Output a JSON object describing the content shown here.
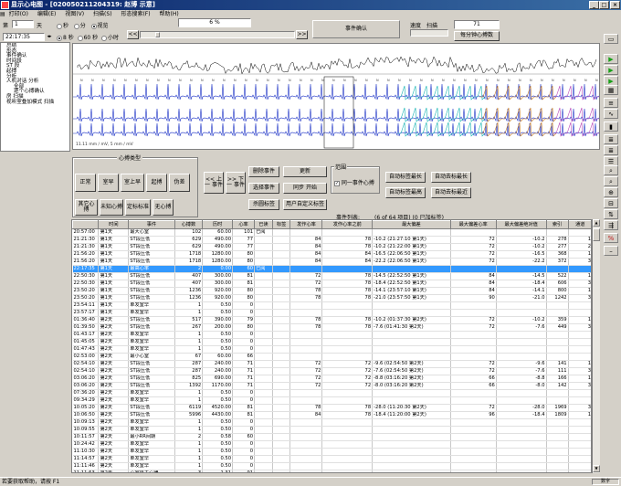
{
  "title": "显示心电图 - [020050211204319: 赵博 示意]",
  "menu": [
    "打印(O)",
    "编辑(E)",
    "视图(V)",
    "扫描(S)",
    "形态搜索(F)",
    "帮助(H)"
  ],
  "controls": {
    "day_label": "第",
    "day_value": "1",
    "day_unit": "天",
    "time_value": "22:17:35",
    "interval_options": [
      "秒",
      "分",
      "视览"
    ],
    "hour_options": [
      "8 秒",
      "60 秒",
      "小时"
    ],
    "percent_value": "6 %",
    "prev_label": "<<",
    "next_label": ">>",
    "event_confirm_label": "事件确认",
    "speed_label": "速度",
    "scan_label": "扫描",
    "speed_value": "71",
    "per_min_label": "每分钟心搏数"
  },
  "tree": [
    {
      "text": "总结",
      "indent": 0
    },
    {
      "text": "形态",
      "indent": 0
    },
    {
      "text": "事件确认",
      "indent": 0
    },
    {
      "text": "时间段",
      "indent": 0
    },
    {
      "text": "ST 段",
      "indent": 0
    },
    {
      "text": "起搏",
      "indent": 0
    },
    {
      "text": "分析",
      "indent": 0
    },
    {
      "text": "人机对话 分析",
      "indent": 0
    },
    {
      "text": "全部",
      "indent": 1
    },
    {
      "text": "逐个心搏确认",
      "indent": 1
    },
    {
      "text": "房 扫描",
      "indent": 0
    },
    {
      "text": "视听室叠加模式 扫描",
      "indent": 0
    }
  ],
  "ecg": {
    "scale_note": "11.11 mm / mV, 5 mm / mV"
  },
  "beat_type": {
    "title": "心搏类型",
    "buttons": [
      "正常",
      "室早",
      "室上早",
      "起搏",
      "伪差",
      "其它心搏",
      "未知心搏",
      "定标标准",
      "无心搏"
    ],
    "prev_event": "<< 上一 事件",
    "next_event": ">> 下一 事件"
  },
  "event_buttons": {
    "delete": "删除事件",
    "update": "更新",
    "select": "选择事件",
    "sync_start": "同步 开始",
    "prune": "杀圆标签",
    "custom": "用户自定义标签",
    "range_label": "范围",
    "same_event_label": "同一事件心搏",
    "auto_max": "自动标签最长",
    "auto_min_max": "自动去标最长",
    "auto_all": "自动标签最高",
    "auto_min_all": "自动去标最近"
  },
  "event_list": {
    "title": "事件列表:",
    "info": "(6 of 64 项目) (0 已加标签)",
    "columns": [
      "",
      "时间",
      "事件",
      "心搏数",
      "历时",
      "心率",
      "已读",
      "标签",
      "发作心率",
      "发作心率之前",
      "最大偏差",
      "最大偏差心率",
      "最大偏差绝对值",
      "索引",
      "通道"
    ],
    "rows": [
      [
        "20:57:00",
        "第1天",
        "最大心室",
        102,
        "60.00",
        101,
        "已阅",
        "",
        "",
        "",
        "",
        "",
        "",
        "",
        ""
      ],
      [
        "21:21:30",
        "第1天",
        "ST段压低",
        629,
        "490.00",
        77,
        "",
        "",
        "84",
        "78",
        "-10.2 (21:27:10 第1天)",
        "72",
        "-10.2",
        "278",
        "1"
      ],
      [
        "21:21:30",
        "第1天",
        "ST段压低",
        629,
        "490.00",
        77,
        "",
        "",
        "84",
        "78",
        "-10.2 (21:22:00 第1天)",
        "72",
        "-10.2",
        "277",
        "2"
      ],
      [
        "21:56:20",
        "第1天",
        "ST段压低",
        1718,
        "1280.00",
        80,
        "",
        "",
        "84",
        "84",
        "-16.5 (22:06:50 第1天)",
        "72",
        "-16.5",
        "368",
        "1"
      ],
      [
        "21:56:20",
        "第1天",
        "ST段压低",
        1718,
        "1280.00",
        80,
        "",
        "",
        "84",
        "84",
        "-22.2 (22:06:50 第1天)",
        "72",
        "-22.2",
        "372",
        "3"
      ],
      [
        "22:17:35",
        "第1天",
        "最高心率",
        2,
        "0.00",
        60,
        "已阅",
        "",
        "",
        "",
        "",
        "",
        "",
        "",
        ""
      ],
      [
        "22:50:30",
        "第1天",
        "ST段压低",
        407,
        "300.00",
        81,
        "",
        "",
        "72",
        "78",
        "-14.5 (22:52:50 第1天)",
        "84",
        "-14.5",
        "522",
        "1"
      ],
      [
        "22:50:30",
        "第1天",
        "ST段压低",
        407,
        "300.00",
        81,
        "",
        "",
        "72",
        "78",
        "-18.4 (22:52:50 第1天)",
        "84",
        "-18.4",
        "606",
        "3"
      ],
      [
        "23:50:20",
        "第1天",
        "ST段压低",
        1236,
        "920.00",
        80,
        "",
        "",
        "78",
        "78",
        "-14.1 (23:57:10 第1天)",
        "84",
        "-14.1",
        "800",
        "1"
      ],
      [
        "23:50:20",
        "第1天",
        "ST段压低",
        1236,
        "920.00",
        80,
        "",
        "",
        "78",
        "78",
        "-21.0 (23:57:50 第1天)",
        "90",
        "-21.0",
        "1242",
        "3"
      ],
      [
        "23:54:11",
        "第1天",
        "单发室早",
        1,
        "0.50",
        0,
        "",
        "",
        "",
        "",
        "",
        "",
        "",
        "",
        ""
      ],
      [
        "23:57:17",
        "第1天",
        "单发室早",
        1,
        "0.50",
        0,
        "",
        "",
        "",
        "",
        "",
        "",
        "",
        "",
        ""
      ],
      [
        "01:36:40",
        "第2天",
        "ST段压低",
        517,
        "390.00",
        79,
        "",
        "",
        "78",
        "78",
        "-10.2 (01:37:30 第2天)",
        "72",
        "-10.2",
        "359",
        "1"
      ],
      [
        "01:39:50",
        "第2天",
        "ST段压低",
        267,
        "200.00",
        80,
        "",
        "",
        "78",
        "78",
        "-7.6 (01:41:30 第2天)",
        "72",
        "-7.6",
        "449",
        "3"
      ],
      [
        "01:43:17",
        "第2天",
        "单发室早",
        1,
        "0.50",
        0,
        "",
        "",
        "",
        "",
        "",
        "",
        "",
        "",
        ""
      ],
      [
        "01:45:05",
        "第2天",
        "单发室早",
        1,
        "0.50",
        0,
        "",
        "",
        "",
        "",
        "",
        "",
        "",
        "",
        ""
      ],
      [
        "01:47:43",
        "第2天",
        "单发室早",
        1,
        "0.50",
        0,
        "",
        "",
        "",
        "",
        "",
        "",
        "",
        "",
        ""
      ],
      [
        "02:53:00",
        "第2天",
        "最小心室",
        67,
        "60.00",
        66,
        "",
        "",
        "",
        "",
        "",
        "",
        "",
        "",
        ""
      ],
      [
        "02:54:10",
        "第2天",
        "ST段压低",
        287,
        "240.00",
        71,
        "",
        "",
        "72",
        "72",
        "-9.6 (02:54:50 第2天)",
        "72",
        "-9.6",
        "141",
        "1"
      ],
      [
        "02:54:10",
        "第2天",
        "ST段压低",
        287,
        "240.00",
        71,
        "",
        "",
        "72",
        "72",
        "-7.6 (02:54:50 第2天)",
        "72",
        "-7.6",
        "111",
        "3"
      ],
      [
        "03:06:20",
        "第2天",
        "ST段压低",
        825,
        "690.00",
        71,
        "",
        "",
        "72",
        "72",
        "-8.8 (03:16:20 第2天)",
        "66",
        "-8.8",
        "166",
        "1"
      ],
      [
        "03:06:20",
        "第2天",
        "ST段压低",
        1392,
        "1170.00",
        71,
        "",
        "",
        "72",
        "72",
        "-8.0 (03:16:20 第2天)",
        "66",
        "-8.0",
        "142",
        "3"
      ],
      [
        "07:36:20",
        "第2天",
        "单发室早",
        1,
        "0.50",
        0,
        "",
        "",
        "",
        "",
        "",
        "",
        "",
        "",
        ""
      ],
      [
        "09:34:29",
        "第2天",
        "单发室早",
        1,
        "0.50",
        0,
        "",
        "",
        "",
        "",
        "",
        "",
        "",
        "",
        ""
      ],
      [
        "10:05:20",
        "第2天",
        "ST段压低",
        6119,
        "4520.00",
        81,
        "",
        "",
        "78",
        "78",
        "-28.0 (11:20:30 第2天)",
        "72",
        "-28.0",
        "1969",
        "3"
      ],
      [
        "10:06:50",
        "第2天",
        "ST段压低",
        5996,
        "4430.00",
        81,
        "",
        "",
        "84",
        "78",
        "-18.4 (11:20:00 第2天)",
        "96",
        "-18.4",
        "1809",
        "1"
      ],
      [
        "10:09:13",
        "第2天",
        "单发室早",
        1,
        "0.50",
        0,
        "",
        "",
        "",
        "",
        "",
        "",
        "",
        "",
        ""
      ],
      [
        "10:09:55",
        "第2天",
        "单发室早",
        1,
        "0.50",
        0,
        "",
        "",
        "",
        "",
        "",
        "",
        "",
        "",
        ""
      ],
      [
        "10:11:57",
        "第2天",
        "最小RR间期",
        2,
        "0.58",
        60,
        "",
        "",
        "",
        "",
        "",
        "",
        "",
        "",
        ""
      ],
      [
        "10:24:42",
        "第2天",
        "单发室早",
        1,
        "0.50",
        0,
        "",
        "",
        "",
        "",
        "",
        "",
        "",
        "",
        ""
      ],
      [
        "11:10:30",
        "第2天",
        "单发室早",
        1,
        "0.50",
        0,
        "",
        "",
        "",
        "",
        "",
        "",
        "",
        "",
        ""
      ],
      [
        "11:14:57",
        "第2天",
        "单发室早",
        1,
        "0.50",
        0,
        "",
        "",
        "",
        "",
        "",
        "",
        "",
        "",
        ""
      ],
      [
        "11:11:46",
        "第2天",
        "单发室早",
        1,
        "0.50",
        0,
        "",
        "",
        "",
        "",
        "",
        "",
        "",
        "",
        ""
      ],
      [
        "11:11:53",
        "第2天",
        "心室自主心律",
        3,
        "1.31",
        91,
        "",
        "",
        "",
        "",
        "",
        "",
        "",
        "",
        ""
      ],
      [
        "11:11:57",
        "第2天",
        "单发室早",
        1,
        "0.50",
        0,
        "",
        "",
        "",
        "",
        "",
        "",
        "",
        "",
        ""
      ]
    ],
    "selected_index": 5
  },
  "status": "若要获取帮助，请按 F1",
  "status_right": "数字",
  "colors": {
    "titlebar": "#0a246a",
    "selected": "#3399ff",
    "ecg_lead": "#1d33c6",
    "ecg_alt1": "#17b4b4",
    "ecg_alt2": "#c8802a",
    "ecg_alt3": "#b848b8"
  }
}
